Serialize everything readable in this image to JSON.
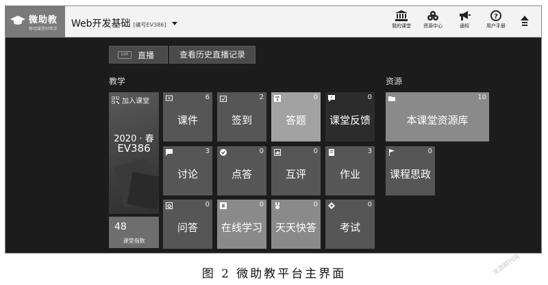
{
  "logo": {
    "title": "微助教",
    "subtitle": "移动课堂好帮手"
  },
  "course": {
    "name": "Web开发基础",
    "id_label": "[编号EV386]"
  },
  "nav": [
    {
      "label": "我的课堂",
      "icon": "bank-icon"
    },
    {
      "label": "资源中心",
      "icon": "boxes-icon"
    },
    {
      "label": "通知",
      "icon": "megaphone-icon"
    },
    {
      "label": "用户手册",
      "icon": "help-icon"
    }
  ],
  "live": {
    "tag": "LIVE",
    "label": "直播",
    "history": "查看历史直播记录"
  },
  "sections": {
    "teaching": "教学",
    "resources": "资源"
  },
  "class_card": {
    "join": "加入课堂",
    "term": "2020 · 春",
    "code": "EV386"
  },
  "index_card": {
    "value": "48",
    "label": "课堂指数"
  },
  "tiles": [
    {
      "label": "课件",
      "count": "6",
      "icon": "slides-icon"
    },
    {
      "label": "签到",
      "count": "2",
      "icon": "checkin-icon"
    },
    {
      "label": "答题",
      "count": "0",
      "icon": "quiz-icon"
    },
    {
      "label": "课堂反馈",
      "count": "0",
      "icon": "feedback-icon"
    },
    {
      "label": "讨论",
      "count": "3",
      "icon": "chat-icon"
    },
    {
      "label": "点答",
      "count": "0",
      "icon": "check-circle-icon"
    },
    {
      "label": "互评",
      "count": "0",
      "icon": "bar-chart-icon"
    },
    {
      "label": "作业",
      "count": "3",
      "icon": "homework-icon"
    },
    {
      "label": "问答",
      "count": "0",
      "icon": "qa-icon"
    },
    {
      "label": "在线学习",
      "count": "0",
      "icon": "online-learning-icon"
    },
    {
      "label": "天天快答",
      "count": "0",
      "icon": "medal-icon"
    },
    {
      "label": "考试",
      "count": "0",
      "icon": "exam-icon"
    }
  ],
  "resource_tiles": [
    {
      "label": "本课堂资源库",
      "count": "10",
      "icon": "folder-icon"
    },
    {
      "label": "课程思政",
      "count": "0",
      "icon": "flag-icon"
    }
  ],
  "caption": "图 2   微助教平台主界面",
  "watermark": "龙源期刊网"
}
